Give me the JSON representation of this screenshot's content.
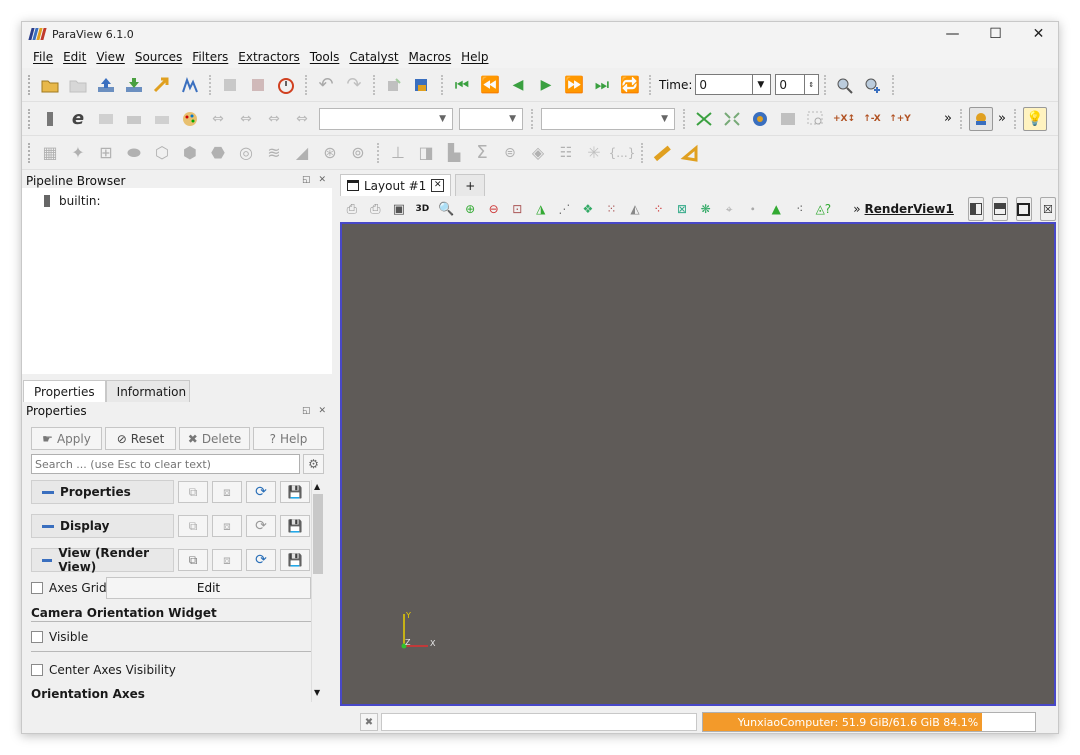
{
  "window": {
    "title": "ParaView 6.1.0",
    "controls": {
      "minimize": "—",
      "maximize": "☐",
      "close": "✕"
    }
  },
  "menu": [
    "File",
    "Edit",
    "View",
    "Sources",
    "Filters",
    "Extractors",
    "Tools",
    "Catalyst",
    "Macros",
    "Help"
  ],
  "toolbar1": {
    "time_label": "Time:",
    "time_value": "0",
    "timestep_value": "0"
  },
  "toolbar2": {
    "more_glyph": "»"
  },
  "pipeline_browser": {
    "title": "Pipeline Browser",
    "items": [
      {
        "label": "builtin:"
      }
    ]
  },
  "properties_panel": {
    "tabs": [
      "Properties",
      "Information"
    ],
    "title": "Properties",
    "buttons": {
      "apply": "Apply",
      "reset": "Reset",
      "delete": "Delete",
      "help": "Help"
    },
    "search_placeholder": "Search ... (use Esc to clear text)",
    "sections": [
      "Properties",
      "Display",
      "View (Render View)"
    ],
    "axes_grid_label": "Axes Grid",
    "edit_label": "Edit",
    "camera_widget_heading": "Camera Orientation Widget",
    "visible_label": "Visible",
    "center_axes_label": "Center Axes Visibility",
    "orientation_axes_heading": "Orientation Axes"
  },
  "layout": {
    "tab_label": "Layout #1",
    "add_tab": "+",
    "view_name": "RenderView1",
    "view_prefix": "»",
    "mode_3d": "3D"
  },
  "render_view": {
    "background": "#5f5b58",
    "axis_labels": {
      "y": "Y",
      "z": "Z",
      "x": "X"
    }
  },
  "status": {
    "memory_text": "YunxiaoComputer: 51.9 GiB/61.6 GiB 84.1%",
    "memory_fraction": 0.841,
    "memory_color": "#f39a2a"
  }
}
